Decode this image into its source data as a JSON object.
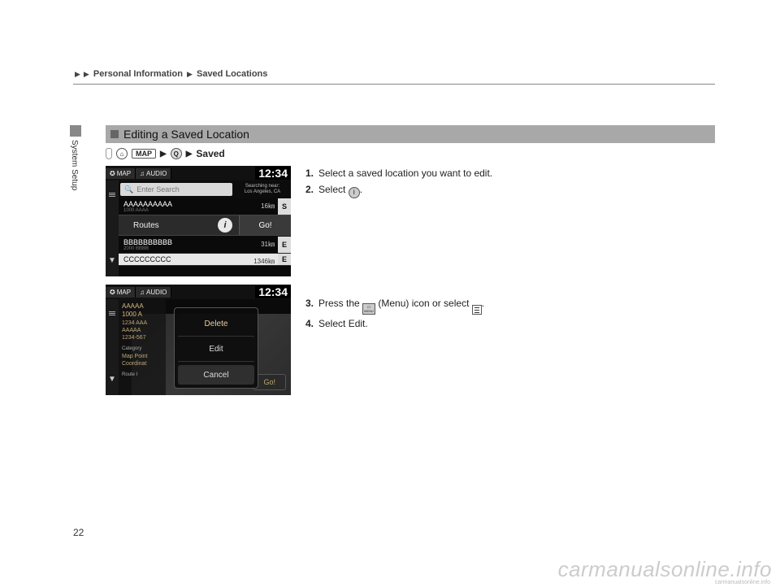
{
  "breadcrumb": {
    "a": "Personal Information",
    "b": "Saved Locations"
  },
  "sidetab": "System Setup",
  "section_title": "Editing a Saved Location",
  "path": {
    "map": "MAP",
    "saved": "Saved"
  },
  "steps": {
    "s1": "Select a saved location you want to edit.",
    "s2a": "Select ",
    "s2b": ".",
    "s3a": "Press the ",
    "s3b": " (Menu) icon or select ",
    "s3c": ".",
    "s4a": "Select ",
    "s4b": "Edit",
    "s4c": "."
  },
  "shot1": {
    "tab_map": "MAP",
    "tab_audio": "AUDIO",
    "clock": "12:34",
    "search_placeholder": "Enter Search",
    "near_label": "Searching near:",
    "near_value": "Los Angeles, CA",
    "items": [
      {
        "name": "AAAAAAAAAA",
        "sub": "1000 AAAA",
        "dist": "16",
        "unit": "㎞",
        "dir": "S"
      },
      {
        "name": "BBBBBBBBBB",
        "sub": "2000 BBBB",
        "dist": "31",
        "unit": "㎞",
        "dir": "E"
      },
      {
        "name": "CCCCCCCCC",
        "sub": "",
        "dist": "1346",
        "unit": "㎞",
        "dir": "E"
      }
    ],
    "routes": "Routes",
    "go": "Go!"
  },
  "shot2": {
    "tab_map": "MAP",
    "tab_audio": "AUDIO",
    "clock": "12:34",
    "left": {
      "title": "AAAAA",
      "addr": "1000 A",
      "l1": "1234 AAA",
      "l2": "AAAAA",
      "l3": "1234-567",
      "cat_h": "Category",
      "cat1": "Map Point",
      "cat2": "Coordinat",
      "route_h": "Route I"
    },
    "popup": {
      "delete": "Delete",
      "edit": "Edit",
      "cancel": "Cancel"
    },
    "go": "Go!"
  },
  "page_number": "22",
  "watermark": "carmanualsonline.info",
  "watermark_sub": "carmanualsonline.info"
}
